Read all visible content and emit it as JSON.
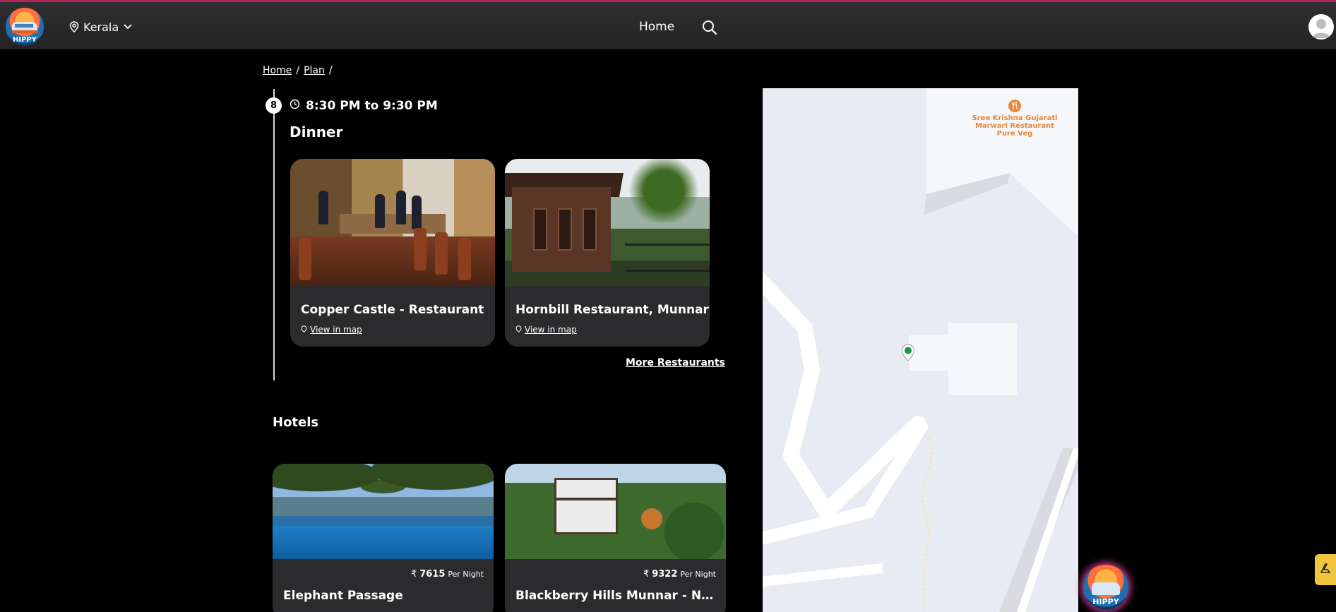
{
  "header": {
    "brand": "HIPPY",
    "location": "Kerala",
    "nav_home": "Home"
  },
  "breadcrumb": {
    "items": [
      "Home",
      "Plan"
    ],
    "separator": "/"
  },
  "itinerary": {
    "step_number": "8",
    "time_range": "8:30 PM to 9:30 PM",
    "slot_title": "Dinner",
    "restaurants": [
      {
        "name": "Copper Castle - Restaurant",
        "map_link": "View in map"
      },
      {
        "name": "Hornbill Restaurant, Munnar",
        "map_link": "View in map"
      }
    ],
    "more_link": "More Restaurants"
  },
  "hotels": {
    "title": "Hotels",
    "currency_symbol": "₹",
    "items": [
      {
        "name": "Elephant Passage",
        "price": "7615",
        "unit": "Per Night"
      },
      {
        "name": "Blackberry Hills Munnar - Nature Resort & Spa",
        "price": "9322",
        "unit": "Per Night"
      }
    ]
  },
  "map": {
    "poi_label": "Sree Krishna Gujarati Marwari Restaurant Pure Veg",
    "poi_color": "#e8863a",
    "marker_color": "#1c9a3c"
  },
  "floating": {
    "brand": "HIPPY"
  },
  "colors": {
    "accent_border": "#b0245f",
    "card_bg": "#2b2b2d",
    "side_tab": "#f2c53d"
  }
}
